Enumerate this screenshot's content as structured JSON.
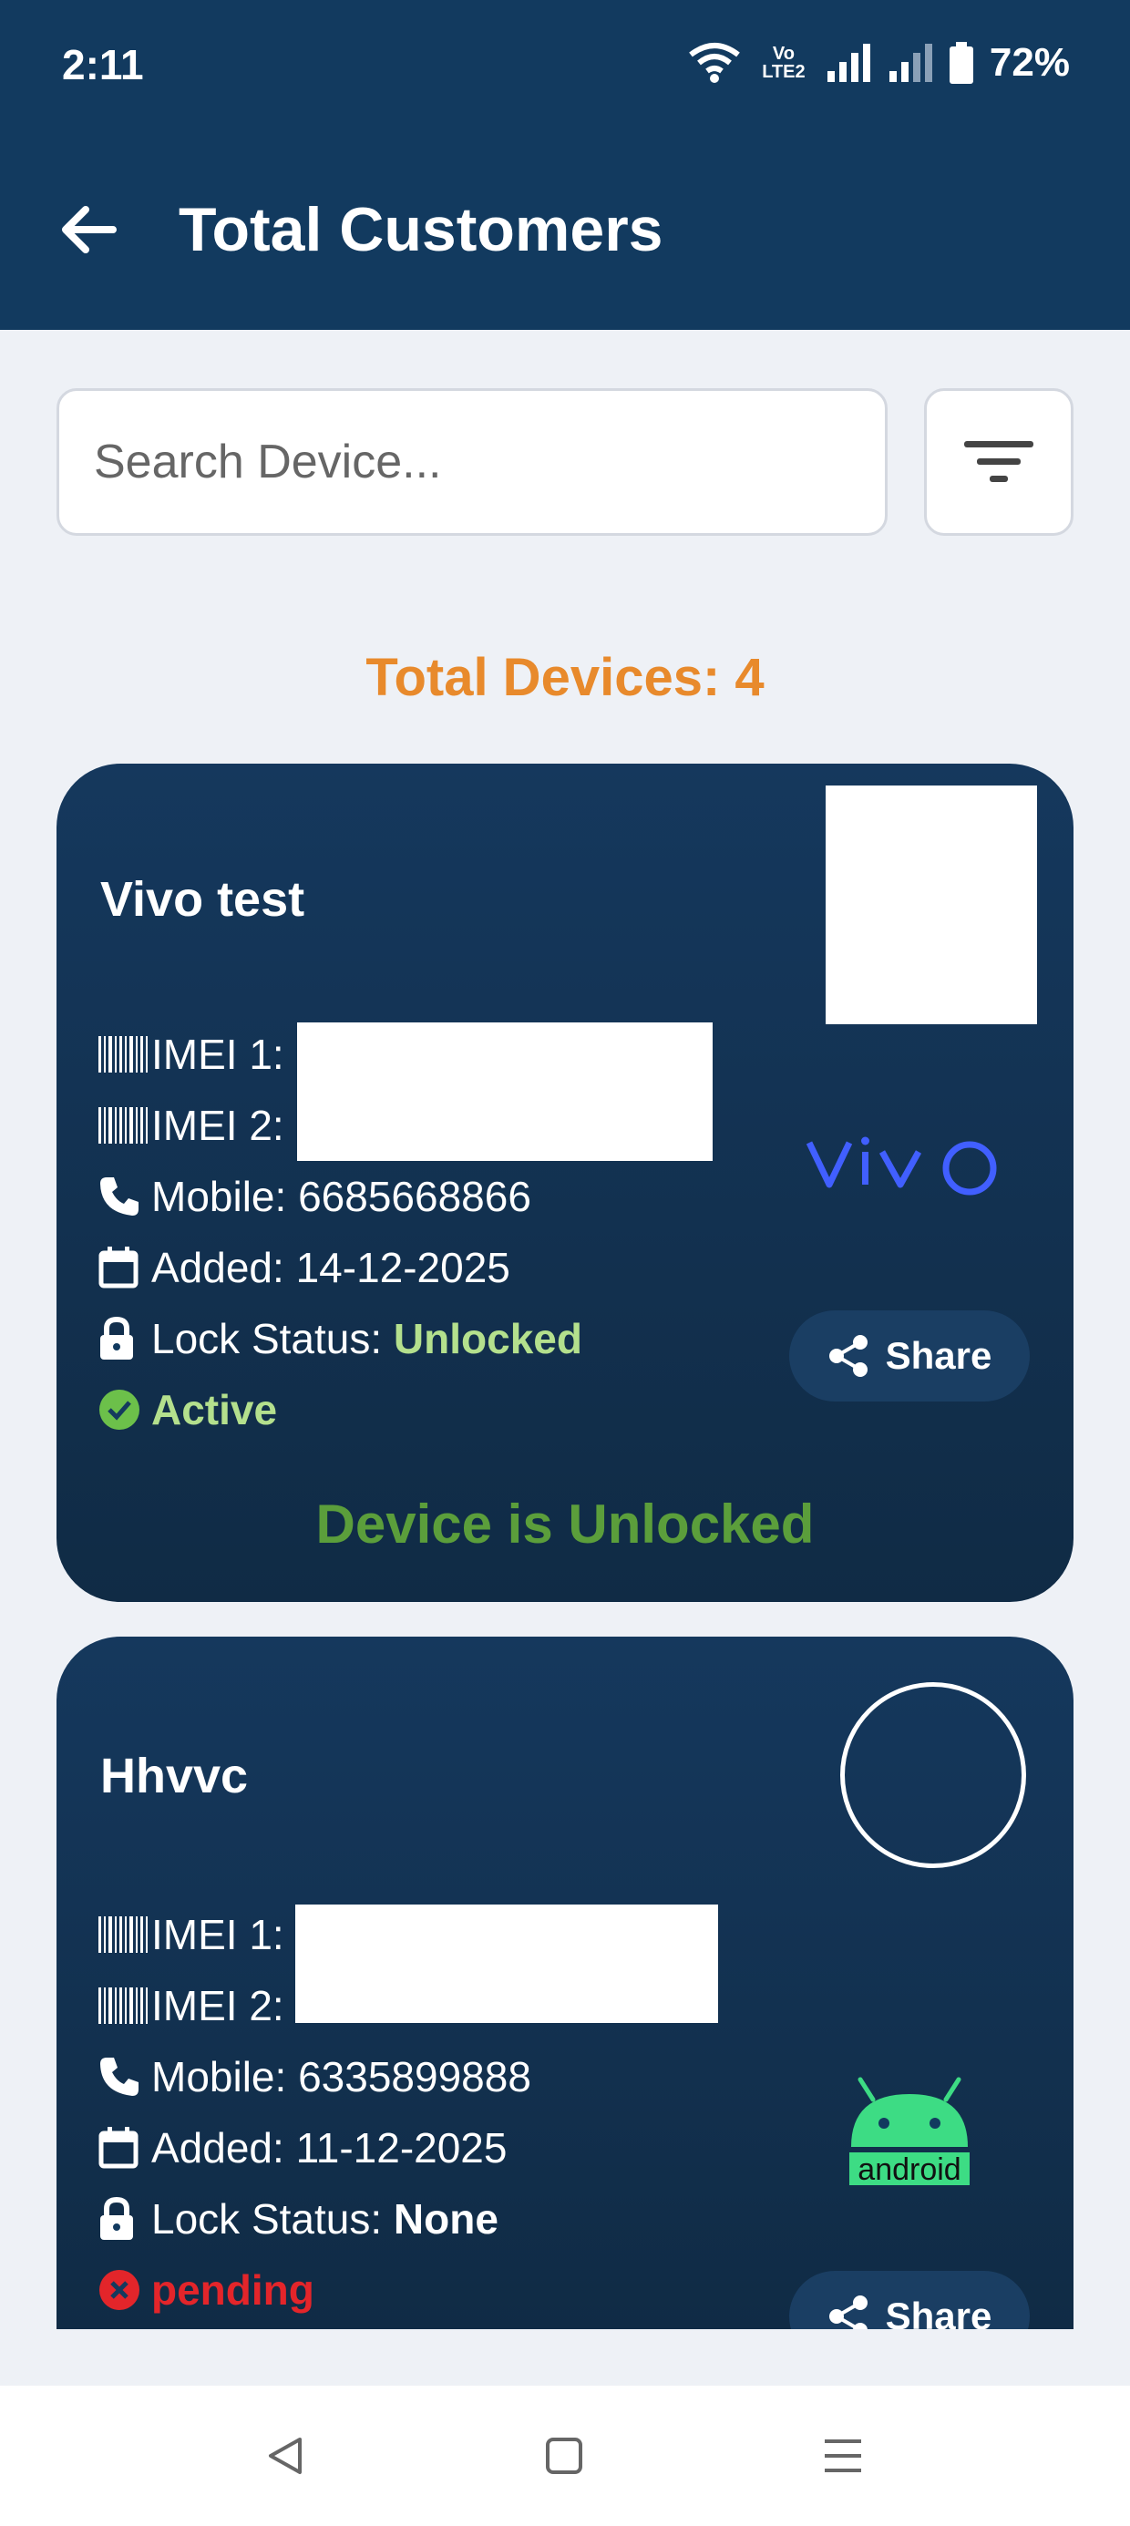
{
  "status_bar": {
    "time": "2:11",
    "network_label": "Vo LTE2",
    "battery": "72%"
  },
  "header": {
    "title": "Total Customers"
  },
  "search": {
    "placeholder": "Search Device..."
  },
  "summary": {
    "total_devices": "Total Devices: 4"
  },
  "devices": [
    {
      "name": "Vivo test",
      "imei1_label": "IMEI 1:",
      "imei2_label": "IMEI 2:",
      "mobile_label": "Mobile: ",
      "mobile": "6685668866",
      "added_label": "Added: ",
      "added": "14-12-2025",
      "lock_label": "Lock Status: ",
      "lock_status": "Unlocked",
      "status": "Active",
      "brand": "vivo",
      "share_label": "Share",
      "message": "Device is Unlocked"
    },
    {
      "name": "Hhvvc",
      "imei1_label": "IMEI 1:",
      "imei2_label": "IMEI 2:",
      "mobile_label": "Mobile: ",
      "mobile": "6335899888",
      "added_label": "Added: ",
      "added": "11-12-2025",
      "lock_label": "Lock Status: ",
      "lock_status": "None",
      "status": "pending",
      "brand": "android",
      "share_label": "Share"
    }
  ],
  "colors": {
    "header_bg": "#123a5f",
    "accent_orange": "#e88a2c",
    "unlocked_green": "#b4e08d",
    "message_green": "#5b9e3b",
    "pending_red": "#e3252a",
    "android_green": "#3ddc84",
    "vivo_blue": "#415fff"
  },
  "icons": {
    "back": "arrow-left-icon",
    "filter": "filter-icon",
    "imei": "barcode-icon",
    "mobile": "phone-icon",
    "added": "calendar-icon",
    "lock": "lock-icon",
    "active": "check-circle-icon",
    "pending": "x-circle-icon",
    "share": "share-icon"
  }
}
